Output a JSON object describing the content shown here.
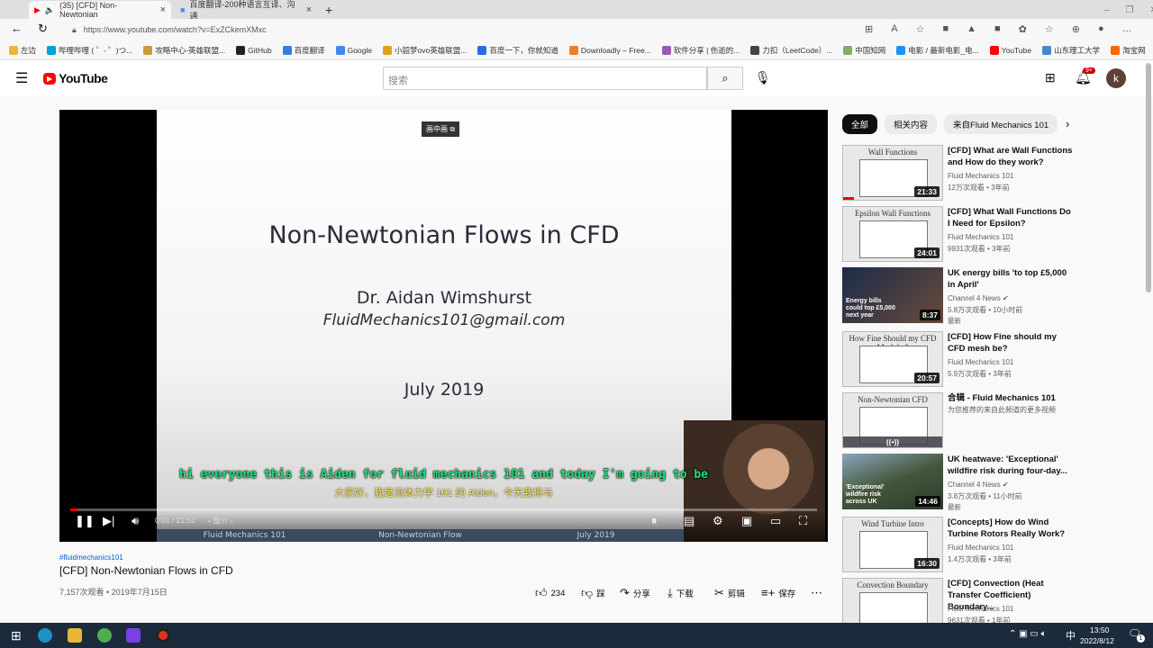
{
  "browser": {
    "tabs": [
      {
        "label": "(35) [CFD] Non-Newtonian"
      },
      {
        "label": "百度翻译-200种语言互译、沟通"
      }
    ],
    "url": "https://www.youtube.com/watch?v=ExZCkemXMxc",
    "bookmarks": [
      "左边",
      "哔哩哔哩 ( ゜- ゜)つ...",
      "攻略中心-英雄联盟...",
      "GitHub",
      "百度翻译",
      "Google",
      "小韶梦ovo英雄联盟...",
      "百度一下，你就知道",
      "Downloadly – Free...",
      "软件分享 | 伤逝的...",
      "力扣（LeetCode）...",
      "中国知网",
      "电影 / 最新电影_电...",
      "YouTube",
      "山东理工大学",
      "淘宝网"
    ]
  },
  "youtube": {
    "logo": "YouTube",
    "search_placeholder": "搜索",
    "notif_count": "9+",
    "avatar": "k"
  },
  "player": {
    "slide_title": "Non-Newtonian Flows in CFD",
    "slide_author": "Dr. Aidan Wimshurst",
    "slide_email": "FluidMechanics101@gmail.com",
    "slide_date": "July 2019",
    "pip_label": "画中画",
    "subtitle_en": "hi everyone this is Aiden for fluid mechanics 101 and today I'm going to be",
    "subtitle_zh": "大家好，我是流体力学 101 的 Aiden，今天我将与",
    "time": "0:01 / 21:52",
    "chapter": "• 简介 ›",
    "progress": 0.001,
    "footer": [
      "Fluid Mechanics 101",
      "Non-Newtonian Flow",
      "July 2019"
    ]
  },
  "video": {
    "hashtag": "#fluidmechanics101",
    "title": "[CFD] Non-Newtonian Flows in CFD",
    "views_date": "7,157次观看 • 2019年7月15日",
    "likes": "234",
    "dislike": "踩",
    "share": "分享",
    "download": "下载",
    "clip": "剪辑",
    "save": "保存"
  },
  "sidebar": {
    "chips": [
      "全部",
      "相关内容",
      "来自Fluid Mechanics 101"
    ],
    "items": [
      {
        "thumb": "Wall Functions",
        "title": "[CFD] What are Wall Functions and How do they work?",
        "channel": "Fluid Mechanics 101",
        "views": "12万次观看 • 3年前",
        "duration": "21:33"
      },
      {
        "thumb": "Epsilon Wall Functions",
        "title": "[CFD] What Wall Functions Do I Need for Epsilon?",
        "channel": "Fluid Mechanics 101",
        "views": "9931次观看 • 3年前",
        "duration": "24:01"
      },
      {
        "thumb": "Energy bills could top £5,000 next year",
        "title": "UK energy bills 'to top £5,000 in April'",
        "channel": "Channel 4 News ✔",
        "views": "5.8万次观看 • 10小时前",
        "badge": "最新",
        "duration": "8:37"
      },
      {
        "thumb": "How Fine Should my CFD Mesh be?",
        "title": "[CFD] How Fine should my CFD mesh be?",
        "channel": "Fluid Mechanics 101",
        "views": "5.9万次观看 • 3年前",
        "duration": "20:57"
      },
      {
        "thumb": "Non-Newtonian CFD",
        "title": "合辑 - Fluid Mechanics 101",
        "channel": "为您推荐的来自此频道的更多视频",
        "views": "",
        "duration": "((•))"
      },
      {
        "thumb": "'Exceptional' wildfire risk across UK",
        "title": "UK heatwave: 'Exceptional' wildfire risk during four-day...",
        "channel": "Channel 4 News ✔",
        "views": "3.8万次观看 • 11小时前",
        "badge": "最新",
        "duration": "14:46"
      },
      {
        "thumb": "Wind Turbine Intro",
        "title": "[Concepts] How do Wind Turbine Rotors Really Work?",
        "channel": "Fluid Mechanics 101",
        "views": "1.4万次观看 • 3年前",
        "duration": "16:30"
      },
      {
        "thumb": "Convection Boundary",
        "title": "[CFD] Convection (Heat Transfer Coefficient) Boundary...",
        "channel": "Fluid Mechanics 101",
        "views": "9631次观看 • 1年前",
        "duration": ""
      }
    ]
  },
  "taskbar": {
    "ime": "中",
    "time": "13:50",
    "date": "2022/8/12",
    "notif": "1"
  }
}
